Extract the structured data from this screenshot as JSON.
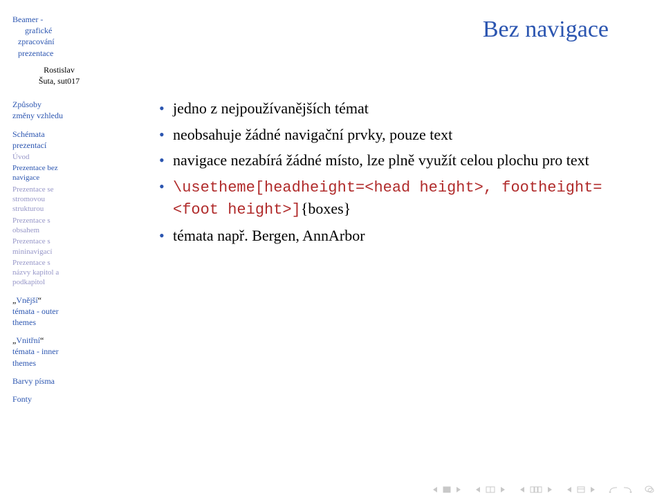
{
  "sidebar": {
    "title_l1": "Beamer -",
    "title_l2": "grafické",
    "title_l3": "zpracování",
    "title_l4": "prezentace",
    "author_l1": "Rostislav",
    "author_l2": "Šuta, sut017",
    "sec_zpusoby_l1": "Způsoby",
    "sec_zpusoby_l2": "změny vzhledu",
    "sec_schemata_l1": "Schémata",
    "sec_schemata_l2": "prezentací",
    "sub_uvod": "Úvod",
    "sub_bez_l1": "Prezentace bez",
    "sub_bez_l2": "navigace",
    "sub_strom_l1": "Prezentace se",
    "sub_strom_l2": "stromovou",
    "sub_strom_l3": "strukturou",
    "sub_obsah_l1": "Prezentace s",
    "sub_obsah_l2": "obsahem",
    "sub_mini_l1": "Prezentace s",
    "sub_mini_l2": "mininavigací",
    "sub_nazvy_l1": "Prezentace s",
    "sub_nazvy_l2": "názvy kapitol a",
    "sub_nazvy_l3": "podkapitol",
    "sec_outer_q1": "„",
    "sec_outer_w": "Vnější",
    "sec_outer_q2": "“",
    "sec_outer_l2": "témata - outer",
    "sec_outer_l3": "themes",
    "sec_inner_q1": "„",
    "sec_inner_w": "Vnitřní",
    "sec_inner_q2": "“",
    "sec_inner_l2": "témata - inner",
    "sec_inner_l3": "themes",
    "sec_barvy": "Barvy písma",
    "sec_fonty": "Fonty"
  },
  "frame": {
    "title": "Bez navigace",
    "b1": "jedno z nejpoužívanějších témat",
    "b2": "neobsahuje žádné navigační prvky, pouze text",
    "b3": "navigace nezabírá žádné místo, lze plně využít celou plochu pro text",
    "b4_pre": "\\usetheme[headheight=<head height>, footheight=<foot height>]",
    "b4_post": "{boxes}",
    "b5": "témata např. Bergen, AnnArbor"
  },
  "nav": {
    "first": "first-slide",
    "prev": "prev-slide",
    "up": "prev-section",
    "down": "next-section",
    "next": "next-slide",
    "last": "last-slide",
    "back": "go-back",
    "forward": "go-forward",
    "search": "search"
  }
}
